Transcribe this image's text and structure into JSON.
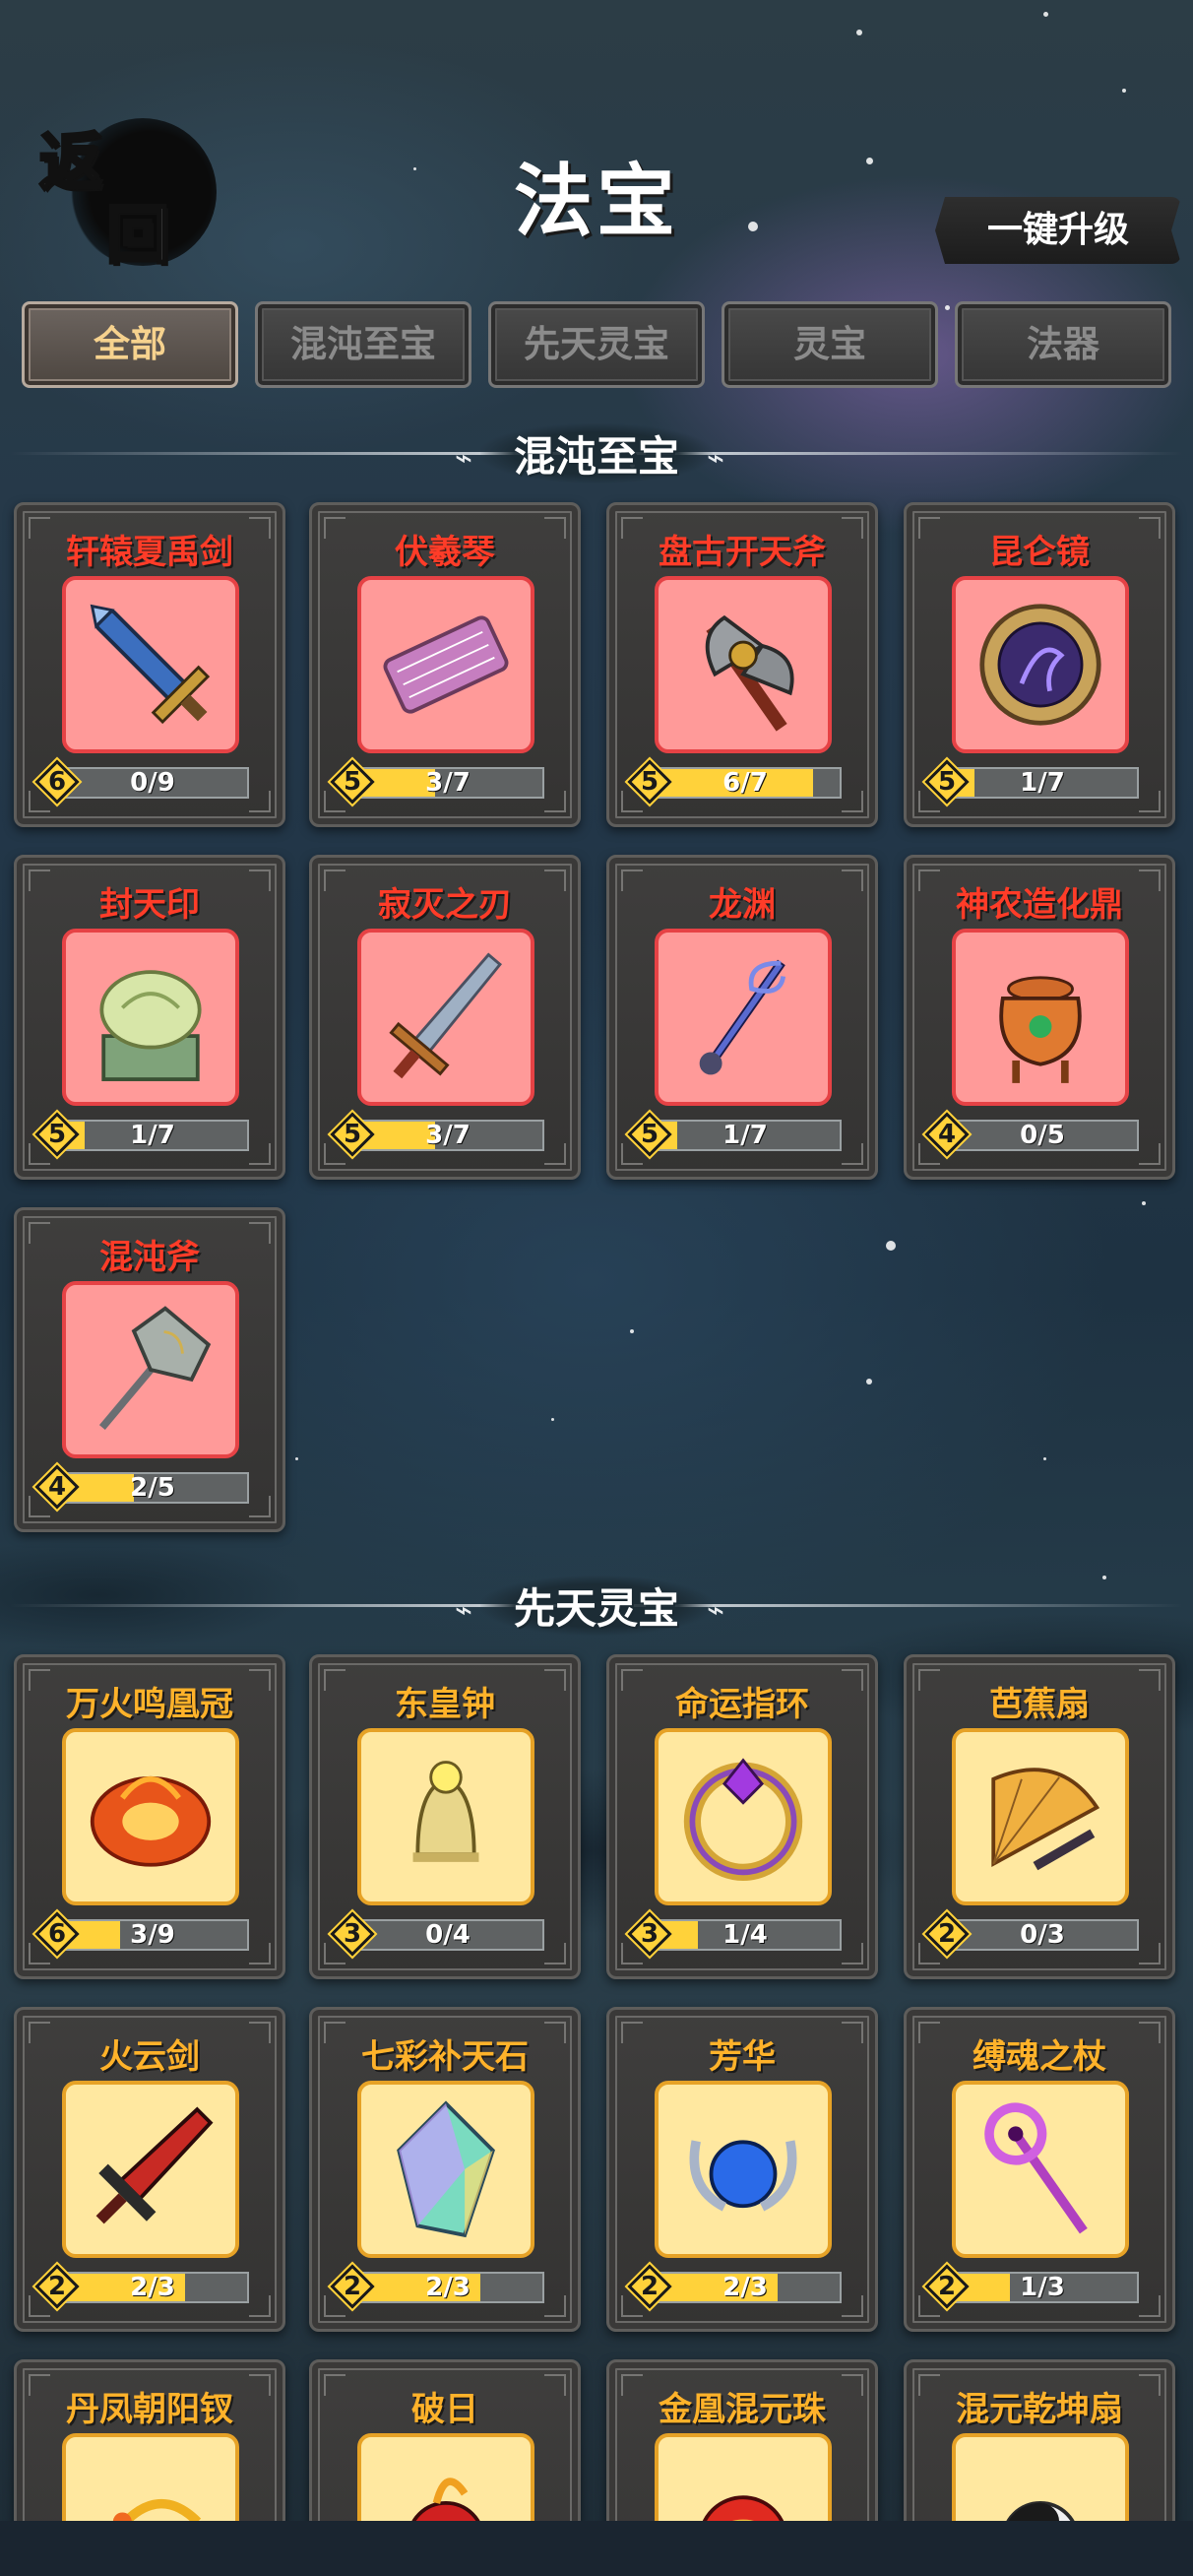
{
  "header": {
    "back_char_1": "返",
    "back_char_2": "回",
    "title": "法宝",
    "upgrade_label": "一键升级"
  },
  "tabs": [
    {
      "label": "全部",
      "active": true
    },
    {
      "label": "混沌至宝",
      "active": false
    },
    {
      "label": "先天灵宝",
      "active": false
    },
    {
      "label": "灵宝",
      "active": false
    },
    {
      "label": "法器",
      "active": false
    }
  ],
  "sections": [
    {
      "title": "混沌至宝",
      "rarity": "red",
      "items": [
        {
          "name": "轩辕夏禹剑",
          "level": 6,
          "progress": "0/9",
          "ratio": 0.0,
          "icon": "sword-icon"
        },
        {
          "name": "伏羲琴",
          "level": 5,
          "progress": "3/7",
          "ratio": 0.43,
          "icon": "qin-icon"
        },
        {
          "name": "盘古开天斧",
          "level": 5,
          "progress": "6/7",
          "ratio": 0.86,
          "icon": "axe-icon"
        },
        {
          "name": "昆仑镜",
          "level": 5,
          "progress": "1/7",
          "ratio": 0.14,
          "icon": "mirror-icon"
        },
        {
          "name": "封天印",
          "level": 5,
          "progress": "1/7",
          "ratio": 0.14,
          "icon": "seal-icon"
        },
        {
          "name": "寂灭之刃",
          "level": 5,
          "progress": "3/7",
          "ratio": 0.43,
          "icon": "blade-icon"
        },
        {
          "name": "龙渊",
          "level": 5,
          "progress": "1/7",
          "ratio": 0.14,
          "icon": "dragon-staff-icon"
        },
        {
          "name": "神农造化鼎",
          "level": 4,
          "progress": "0/5",
          "ratio": 0.0,
          "icon": "cauldron-icon"
        },
        {
          "name": "混沌斧",
          "level": 4,
          "progress": "2/5",
          "ratio": 0.4,
          "icon": "halberd-icon"
        }
      ]
    },
    {
      "title": "先天灵宝",
      "rarity": "gold",
      "items": [
        {
          "name": "万火鸣凰冠",
          "level": 6,
          "progress": "3/9",
          "ratio": 0.33,
          "icon": "phoenix-crown-icon"
        },
        {
          "name": "东皇钟",
          "level": 3,
          "progress": "0/4",
          "ratio": 0.0,
          "icon": "bell-icon"
        },
        {
          "name": "命运指环",
          "level": 3,
          "progress": "1/4",
          "ratio": 0.25,
          "icon": "ring-icon"
        },
        {
          "name": "芭蕉扇",
          "level": 2,
          "progress": "0/3",
          "ratio": 0.0,
          "icon": "fan-icon"
        },
        {
          "name": "火云剑",
          "level": 2,
          "progress": "2/3",
          "ratio": 0.67,
          "icon": "fire-sword-icon"
        },
        {
          "name": "七彩补天石",
          "level": 2,
          "progress": "2/3",
          "ratio": 0.67,
          "icon": "crystal-icon"
        },
        {
          "name": "芳华",
          "level": 2,
          "progress": "2/3",
          "ratio": 0.67,
          "icon": "orb-icon"
        },
        {
          "name": "缚魂之杖",
          "level": 2,
          "progress": "1/3",
          "ratio": 0.33,
          "icon": "soul-staff-icon"
        },
        {
          "name": "丹凤朝阳钗",
          "icon": "hairpin-icon"
        },
        {
          "name": "破日",
          "icon": "sun-icon"
        },
        {
          "name": "金凰混元珠",
          "icon": "pearl-icon"
        },
        {
          "name": "混元乾坤扇",
          "icon": "taiji-fan-icon"
        }
      ]
    }
  ],
  "colors": {
    "red_name": "#ff3c28",
    "gold_name": "#ffb22a",
    "red_frame": "#ff9a99",
    "gold_frame": "#ffe8a0",
    "bar_fill": "#ffd23a",
    "active_tab_text": "#f6d28e"
  }
}
